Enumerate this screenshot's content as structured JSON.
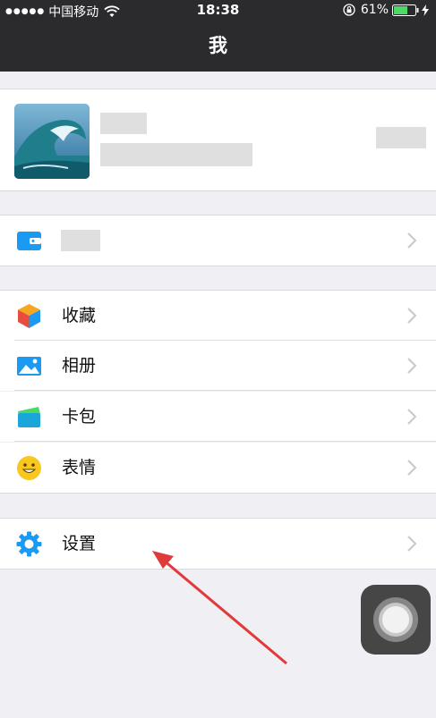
{
  "status_bar": {
    "signal": "●●●●●",
    "carrier": "中国移动",
    "time": "18:38",
    "battery": "61%"
  },
  "nav": {
    "title": "我"
  },
  "profile": {
    "avatar": "wave-photo"
  },
  "wallet": {
    "icon": "wallet-icon"
  },
  "menu": [
    {
      "label": "收藏",
      "icon": "favorites-cube-icon"
    },
    {
      "label": "相册",
      "icon": "album-photo-icon"
    },
    {
      "label": "卡包",
      "icon": "card-pack-icon"
    },
    {
      "label": "表情",
      "icon": "emoji-smile-icon"
    }
  ],
  "settings": {
    "label": "设置",
    "icon": "gear-icon"
  },
  "colors": {
    "nav_bg": "#2b2b2e",
    "page_bg": "#efeff4",
    "accent_blue": "#1a9af2",
    "arrow_red": "#e03a3a"
  }
}
